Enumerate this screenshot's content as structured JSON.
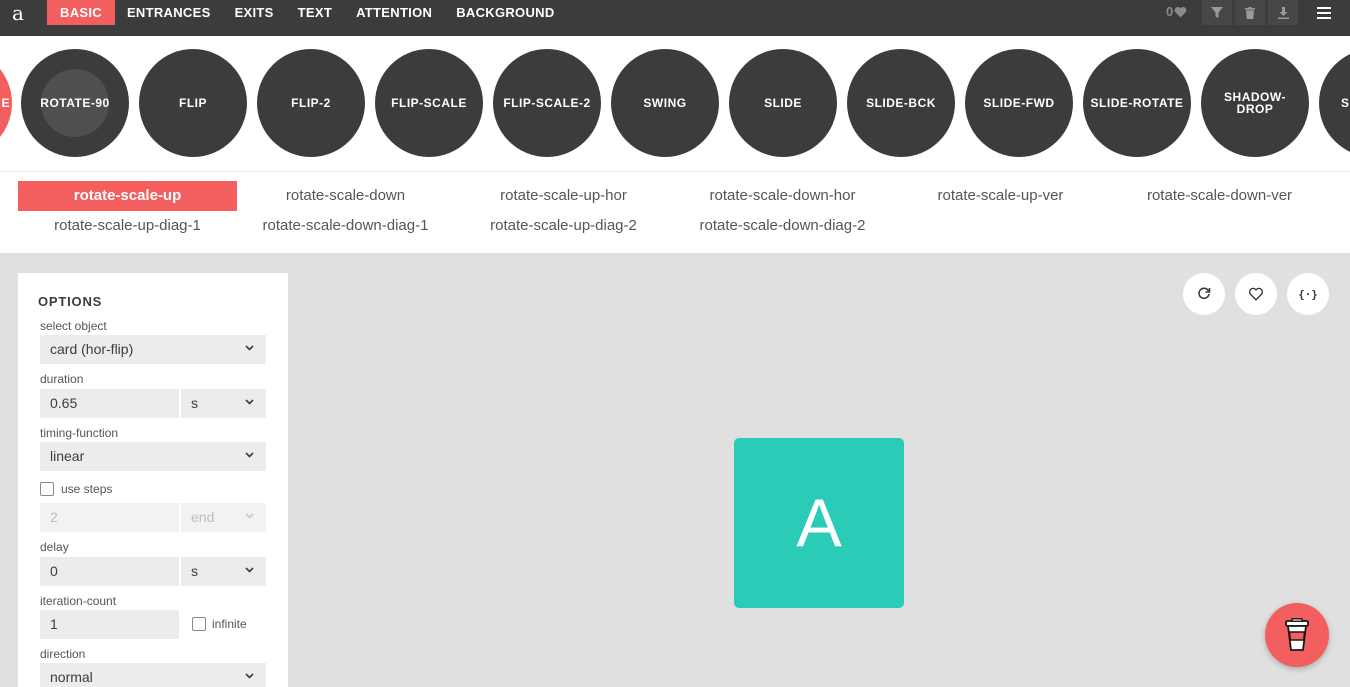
{
  "app": {
    "logo": "a"
  },
  "nav": {
    "items": [
      "BASIC",
      "ENTRANCES",
      "EXITS",
      "TEXT",
      "ATTENTION",
      "BACKGROUND"
    ],
    "active": "BASIC"
  },
  "toolbar": {
    "fav_count": "0",
    "icons": [
      "heart-icon",
      "filter-icon",
      "trash-icon",
      "download-icon",
      "hamburger-menu-icon"
    ]
  },
  "groups": {
    "items": [
      "ROTATE-90",
      "FLIP",
      "FLIP-2",
      "FLIP-SCALE",
      "FLIP-SCALE-2",
      "SWING",
      "SLIDE",
      "SLIDE-BCK",
      "SLIDE-FWD",
      "SLIDE-ROTATE",
      "SHADOW-\nDROP",
      "S"
    ],
    "partial_left_label": "E"
  },
  "variants": {
    "row1": [
      "rotate-scale-up",
      "rotate-scale-down",
      "rotate-scale-up-hor",
      "rotate-scale-down-hor",
      "rotate-scale-up-ver",
      "rotate-scale-down-ver"
    ],
    "row2": [
      "rotate-scale-up-diag-1",
      "rotate-scale-down-diag-1",
      "rotate-scale-up-diag-2",
      "rotate-scale-down-diag-2"
    ],
    "active": "rotate-scale-up"
  },
  "options": {
    "title": "OPTIONS",
    "select_object_label": "select object",
    "select_object_value": "card (hor-flip)",
    "duration_label": "duration",
    "duration_value": "0.65",
    "duration_unit": "s",
    "timing_label": "timing-function",
    "timing_value": "linear",
    "use_steps_label": "use steps",
    "steps_value": "2",
    "steps_position": "end",
    "delay_label": "delay",
    "delay_value": "0",
    "delay_unit": "s",
    "iteration_label": "iteration-count",
    "iteration_value": "1",
    "infinite_label": "infinite",
    "direction_label": "direction",
    "direction_value": "normal"
  },
  "stage": {
    "card_letter": "A",
    "buttons": [
      "replay-icon",
      "heart-icon",
      "code-icon"
    ],
    "code_glyph": "{·}"
  },
  "colors": {
    "accent": "#f35e5e",
    "dark": "#3c3c3c",
    "card": "#2ccbb8",
    "stage_bg": "#e0e0e0"
  }
}
